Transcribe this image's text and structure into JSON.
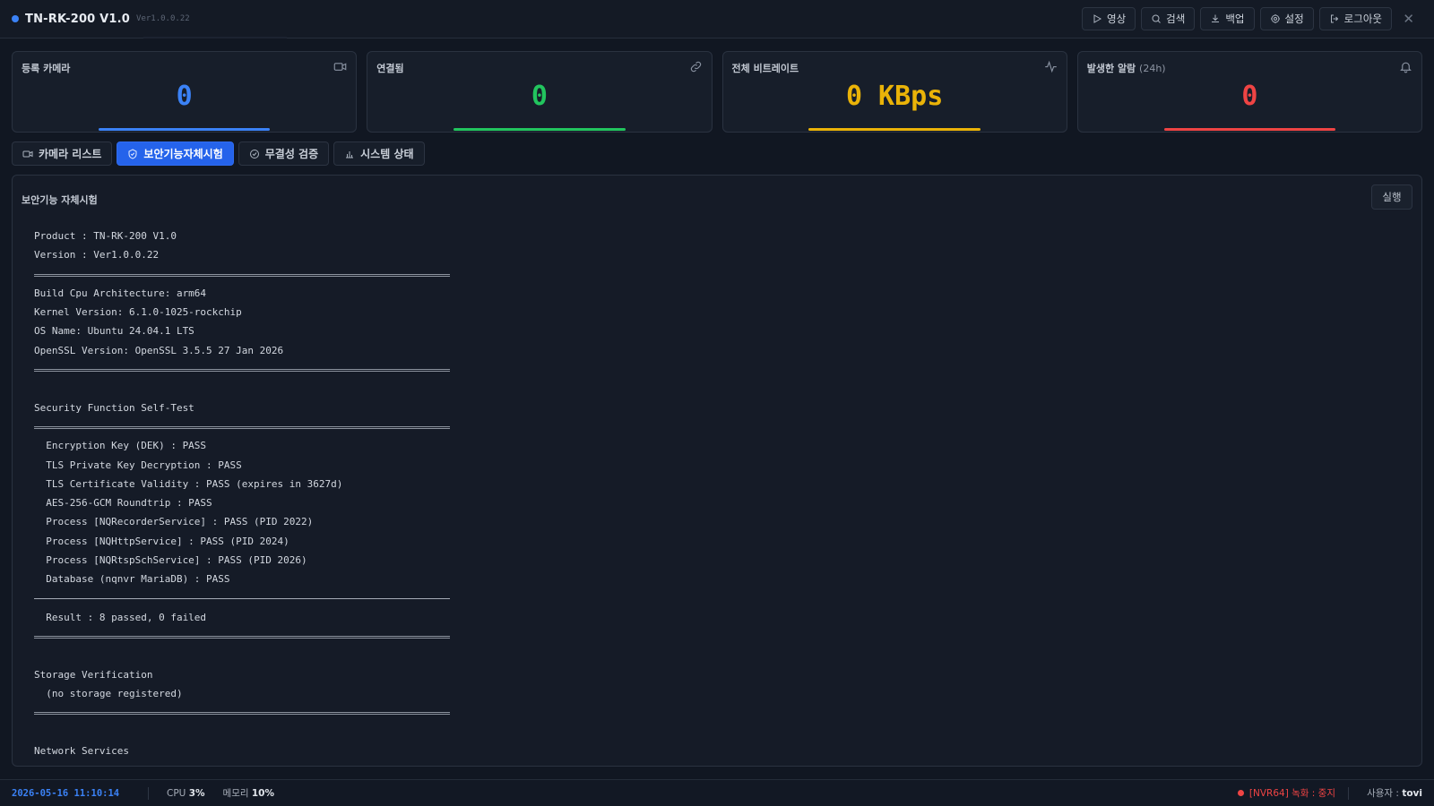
{
  "header": {
    "title": "TN-RK-200 V1.0",
    "version": "Ver1.0.0.22",
    "actions": [
      {
        "label": "영상",
        "icon": "play-icon"
      },
      {
        "label": "검색",
        "icon": "search-icon"
      },
      {
        "label": "백업",
        "icon": "download-icon"
      },
      {
        "label": "설정",
        "icon": "gear-icon"
      },
      {
        "label": "로그아웃",
        "icon": "logout-icon"
      }
    ],
    "close": "✕"
  },
  "cards": [
    {
      "label": "등록 카메라",
      "sub": "",
      "value": "0",
      "color": "#3b82f6",
      "icon": "camera-icon"
    },
    {
      "label": "연결됨",
      "sub": "",
      "value": "0",
      "color": "#22c55e",
      "icon": "link-icon"
    },
    {
      "label": "전체 비트레이트",
      "sub": "",
      "value": "0 KBps",
      "color": "#eab308",
      "icon": "activity-icon"
    },
    {
      "label": "발생한 알람",
      "sub": "(24h)",
      "value": "0",
      "color": "#ef4444",
      "icon": "bell-icon"
    }
  ],
  "tabs": [
    {
      "label": "카메라 리스트",
      "icon": "camera-icon",
      "active": false
    },
    {
      "label": "보안기능자체시험",
      "icon": "shield-check-icon",
      "active": true
    },
    {
      "label": "무결성 검증",
      "icon": "check-circle-icon",
      "active": false
    },
    {
      "label": "시스템 상태",
      "icon": "bar-chart-icon",
      "active": false
    }
  ],
  "panel": {
    "title": "보안기능 자체시험",
    "run_label": "실행",
    "log": [
      {
        "t": "line",
        "text": "Product : TN-RK-200 V1.0"
      },
      {
        "t": "line",
        "text": "Version : Ver1.0.0.22"
      },
      {
        "t": "sep"
      },
      {
        "t": "line",
        "text": "Build Cpu Architecture: arm64"
      },
      {
        "t": "line",
        "text": "Kernel Version: 6.1.0-1025-rockchip"
      },
      {
        "t": "line",
        "text": "OS Name: Ubuntu 24.04.1 LTS"
      },
      {
        "t": "line",
        "text": "OpenSSL Version: OpenSSL 3.5.5 27 Jan 2026"
      },
      {
        "t": "sep"
      },
      {
        "t": "blank"
      },
      {
        "t": "line",
        "text": "Security Function Self-Test"
      },
      {
        "t": "sep"
      },
      {
        "t": "line",
        "text": "  Encryption Key (DEK) : PASS"
      },
      {
        "t": "line",
        "text": "  TLS Private Key Decryption : PASS"
      },
      {
        "t": "line",
        "text": "  TLS Certificate Validity : PASS (expires in 3627d)"
      },
      {
        "t": "line",
        "text": "  AES-256-GCM Roundtrip : PASS"
      },
      {
        "t": "line",
        "text": "  Process [NQRecorderService] : PASS (PID 2022)"
      },
      {
        "t": "line",
        "text": "  Process [NQHttpService] : PASS (PID 2024)"
      },
      {
        "t": "line",
        "text": "  Process [NQRtspSchService] : PASS (PID 2026)"
      },
      {
        "t": "line",
        "text": "  Database (nqnvr MariaDB) : PASS"
      },
      {
        "t": "thin"
      },
      {
        "t": "line",
        "text": "  Result : 8 passed, 0 failed"
      },
      {
        "t": "sep"
      },
      {
        "t": "blank"
      },
      {
        "t": "line",
        "text": "Storage Verification"
      },
      {
        "t": "line",
        "text": "  (no storage registered)"
      },
      {
        "t": "sep"
      },
      {
        "t": "blank"
      },
      {
        "t": "line",
        "text": "Network Services"
      }
    ]
  },
  "footer": {
    "datetime": "2026-05-16 11:10:14",
    "cpu_label": "CPU",
    "cpu_value": "3%",
    "mem_label": "메모리",
    "mem_value": "10%",
    "recording": "[NVR64] 녹화 : 중지",
    "user_label": "사용자 :",
    "user_value": "tovi"
  }
}
